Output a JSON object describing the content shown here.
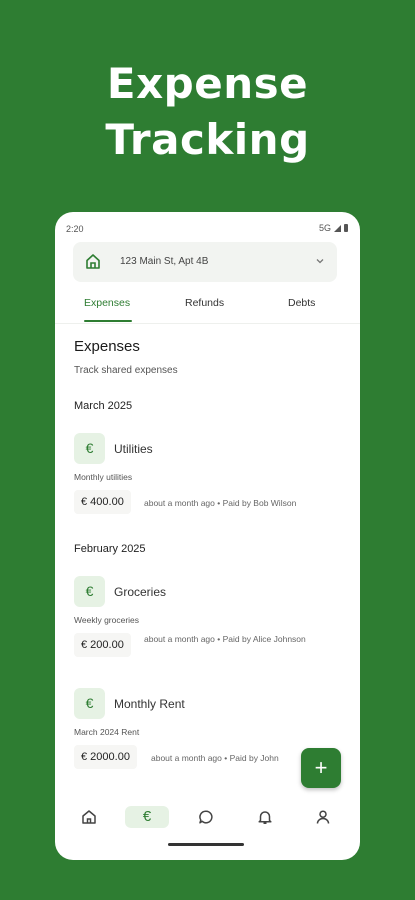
{
  "promo": {
    "line1": "Expense",
    "line2": "Tracking"
  },
  "status_bar": {
    "time": "2:20",
    "network": "5G"
  },
  "property": {
    "address": "123 Main St, Apt 4B",
    "icon": "home-icon"
  },
  "tabs": [
    {
      "label": "Expenses",
      "active": true
    },
    {
      "label": "Refunds",
      "active": false
    },
    {
      "label": "Debts",
      "active": false
    }
  ],
  "page": {
    "title": "Expenses",
    "subtitle": "Track shared expenses"
  },
  "groups": [
    {
      "month": "March 2025",
      "items": [
        {
          "symbol": "€",
          "name": "Utilities",
          "description": "Monthly utilities",
          "amount": "€ 400.00",
          "meta": "about a month ago • Paid by Bob Wilson"
        }
      ]
    },
    {
      "month": "February 2025",
      "items": [
        {
          "symbol": "€",
          "name": "Groceries",
          "description": "Weekly groceries",
          "amount": "€ 200.00",
          "meta": "about a month ago • Paid by Alice Johnson"
        },
        {
          "symbol": "€",
          "name": "Monthly Rent",
          "description": "March 2024 Rent",
          "amount": "€ 2000.00",
          "meta": "about a month ago • Paid by John"
        }
      ]
    }
  ],
  "fab": {
    "symbol": "+",
    "icon": "plus-icon"
  },
  "nav": [
    {
      "icon": "home-icon",
      "active": false
    },
    {
      "icon": "euro-icon",
      "symbol": "€",
      "active": true
    },
    {
      "icon": "chat-icon",
      "active": false
    },
    {
      "icon": "bell-icon",
      "active": false
    },
    {
      "icon": "profile-icon",
      "active": false
    }
  ],
  "colors": {
    "brand": "#2e7d32",
    "accent_tint": "#e6f2e4",
    "surface": "#ffffff"
  }
}
